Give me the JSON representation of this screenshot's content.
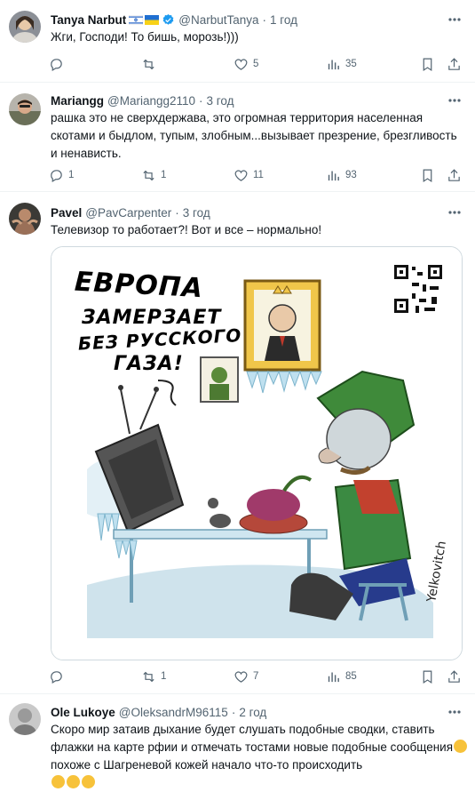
{
  "tweets": [
    {
      "name": "Tanya Narbut",
      "handle": "@NarbutTanya",
      "time": "1 год",
      "text": "Жги, Господи! То бишь, морозь!)))",
      "reply_count": "",
      "repost_count": "",
      "like_count": "5",
      "view_count": "35"
    },
    {
      "name": "Mariangg",
      "handle": "@Mariangg2110",
      "time": "3 год",
      "text": "рашка это не сверхдержава, это огромная территория населенная скотами и быдлом, тупым, злобным...вызывает презрение, брезгливость и ненависть.",
      "reply_count": "1",
      "repost_count": "1",
      "like_count": "11",
      "view_count": "93"
    },
    {
      "name": "Pavel",
      "handle": "@PavCarpenter",
      "time": "3 год",
      "text": "Телевизор то работает?! Вот и все – нормально!",
      "reply_count": "",
      "repost_count": "1",
      "like_count": "7",
      "view_count": "85",
      "cartoon": {
        "line1": "ЕВРОПА",
        "line2": "ЗАМЕРЗАЕТ",
        "line3": "БЕЗ РУССКОГО",
        "line4": "ГАЗА!",
        "signature": "Yelkovitch"
      }
    },
    {
      "name": "Ole Lukoye",
      "handle": "@OleksandrM96115",
      "time": "2 год",
      "text": "Скоро мир затаив дыхание будет слушать подобные сводки,  ставить флажки на карте рфии  и отмечать тостами новые подобные сообщения",
      "text_tail": " похоже с Шагреневой кожей начало что-то происходить"
    }
  ],
  "dot": "·",
  "colors": {
    "accent": "#1d9bf0",
    "muted": "#536471",
    "border": "#eff3f4"
  },
  "icons": [
    "reply-icon",
    "repost-icon",
    "like-icon",
    "views-icon",
    "bookmark-icon",
    "share-icon",
    "more-icon",
    "verified-icon"
  ]
}
